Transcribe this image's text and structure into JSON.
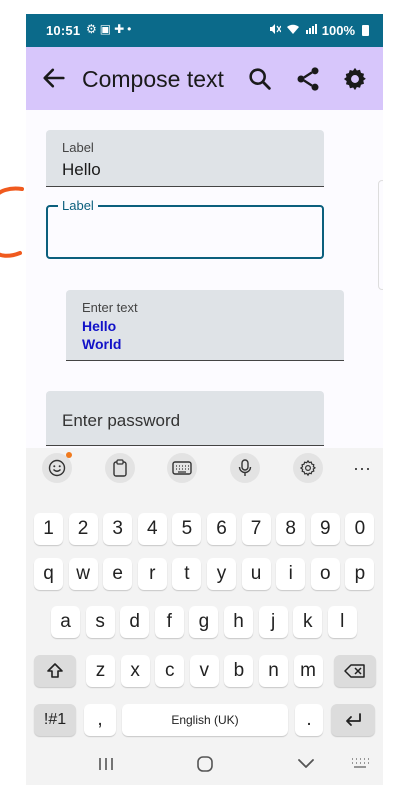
{
  "status_bar": {
    "time": "10:51",
    "left_icons": [
      "gear-icon",
      "photo-icon",
      "settings-badge-icon",
      "dot-icon"
    ],
    "battery_text": "100%",
    "right_icons": [
      "mute-icon",
      "wifi-icon",
      "signal-icon",
      "battery-icon"
    ]
  },
  "app_bar": {
    "title": "Compose text",
    "actions": [
      "search-icon",
      "share-icon",
      "gear-icon"
    ],
    "background": "#d7c6fb"
  },
  "fields": {
    "filled_text": {
      "label": "Label",
      "value": "Hello"
    },
    "outlined_text": {
      "label": "Label",
      "value": ""
    },
    "multiline_text": {
      "label": "Enter text",
      "lines": [
        "Hello",
        "World"
      ],
      "text_color": "#1212c8"
    },
    "password": {
      "placeholder": "Enter password"
    }
  },
  "keyboard": {
    "toolbar": [
      "emoji-icon",
      "clipboard-icon",
      "keyboard-icon",
      "mic-icon",
      "gear-icon",
      "more-icon"
    ],
    "rows": {
      "numbers": [
        "1",
        "2",
        "3",
        "4",
        "5",
        "6",
        "7",
        "8",
        "9",
        "0"
      ],
      "row1": [
        "q",
        "w",
        "e",
        "r",
        "t",
        "y",
        "u",
        "i",
        "o",
        "p"
      ],
      "row2": [
        "a",
        "s",
        "d",
        "f",
        "g",
        "h",
        "j",
        "k",
        "l"
      ],
      "row3": [
        "z",
        "x",
        "c",
        "v",
        "b",
        "n",
        "m"
      ]
    },
    "sym_label": "!#1",
    "comma": ",",
    "space_label": "English (UK)",
    "period": "."
  },
  "colors": {
    "status_bar": "#0b6a8a",
    "focus_outline": "#0b5f7d",
    "annotation": "#f05a1e",
    "field_fill": "#dfe3e7"
  }
}
